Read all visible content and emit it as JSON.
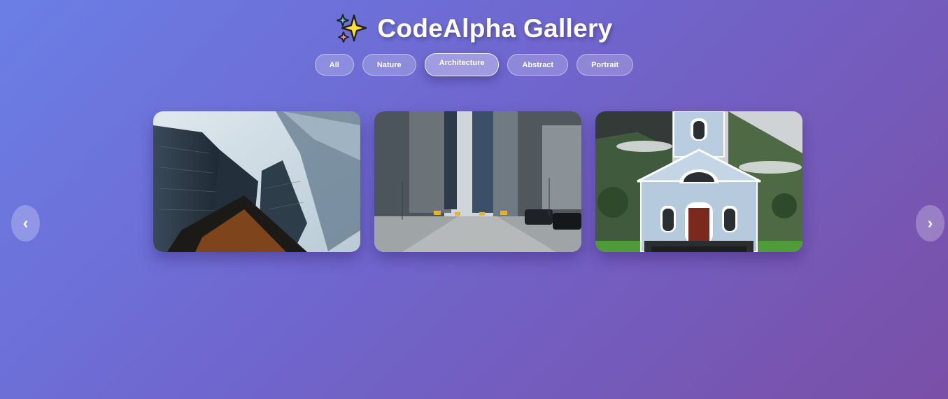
{
  "header": {
    "title": "CodeAlpha Gallery",
    "icon": "sparkles-icon"
  },
  "filters": [
    {
      "label": "All",
      "active": false
    },
    {
      "label": "Nature",
      "active": false
    },
    {
      "label": "Architecture",
      "active": true
    },
    {
      "label": "Abstract",
      "active": false
    },
    {
      "label": "Portrait",
      "active": false
    }
  ],
  "nav": {
    "prev_label": "‹",
    "next_label": "›"
  },
  "gallery": [
    {
      "subject": "skyscrapers-photo"
    },
    {
      "subject": "city-street-photo"
    },
    {
      "subject": "church-photo"
    }
  ],
  "colors": {
    "bg_start": "#6a7fe6",
    "bg_end": "#7a4fa6"
  }
}
